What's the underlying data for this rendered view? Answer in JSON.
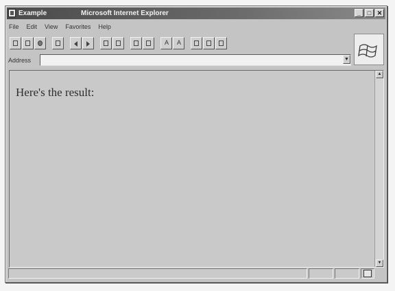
{
  "window": {
    "doc_title": "Example",
    "app_title": "Microsoft Internet Explorer"
  },
  "menu": {
    "items": [
      "File",
      "Edit",
      "View",
      "Favorites",
      "Help"
    ]
  },
  "address": {
    "label": "Address",
    "value": ""
  },
  "page": {
    "text": "Here's the result:"
  },
  "icons": [
    "app-icon",
    "minimize-icon",
    "maximize-icon",
    "close-icon",
    "windows-logo-icon",
    "dropdown-icon",
    "scroll-up-icon",
    "scroll-down-icon",
    "zone-icon"
  ]
}
